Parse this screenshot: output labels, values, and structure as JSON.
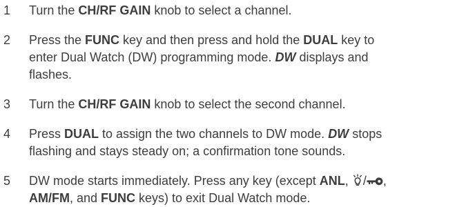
{
  "steps": [
    {
      "number": "1",
      "parts": [
        {
          "t": "Turn the "
        },
        {
          "t": "CH/RF GAIN",
          "s": "b"
        },
        {
          "t": " knob to select a channel."
        }
      ]
    },
    {
      "number": "2",
      "parts": [
        {
          "t": "Press the "
        },
        {
          "t": "FUNC",
          "s": "b"
        },
        {
          "t": " key and then press and hold the "
        },
        {
          "t": "DUAL",
          "s": "b"
        },
        {
          "t": " key to"
        },
        {
          "br": true
        },
        {
          "t": "enter Dual Watch (DW) programming mode. "
        },
        {
          "t": "DW",
          "s": "bi"
        },
        {
          "t": " displays and"
        },
        {
          "br": true
        },
        {
          "t": "flashes."
        }
      ]
    },
    {
      "number": "3",
      "parts": [
        {
          "t": "Turn the "
        },
        {
          "t": "CH/RF GAIN",
          "s": "b"
        },
        {
          "t": " knob to select the second channel."
        }
      ]
    },
    {
      "number": "4",
      "parts": [
        {
          "t": "Press "
        },
        {
          "t": "DUAL",
          "s": "b"
        },
        {
          "t": " to assign the two channels to DW mode. "
        },
        {
          "t": "DW",
          "s": "bi"
        },
        {
          "t": " stops"
        },
        {
          "br": true
        },
        {
          "t": "flashing and stays steady on; a confirmation tone sounds."
        }
      ]
    },
    {
      "number": "5",
      "parts": [
        {
          "t": "DW mode starts immediately. Press any key (except "
        },
        {
          "t": "ANL",
          "s": "b"
        },
        {
          "t": ", "
        },
        {
          "icon": "light-key-icon"
        },
        {
          "t": "/"
        },
        {
          "icon": "key-lock-icon"
        },
        {
          "t": ","
        },
        {
          "br": true
        },
        {
          "t": "AM/FM",
          "s": "b"
        },
        {
          "t": ", and "
        },
        {
          "t": "FUNC",
          "s": "b"
        },
        {
          "t": " keys) to exit Dual Watch mode."
        }
      ]
    }
  ]
}
